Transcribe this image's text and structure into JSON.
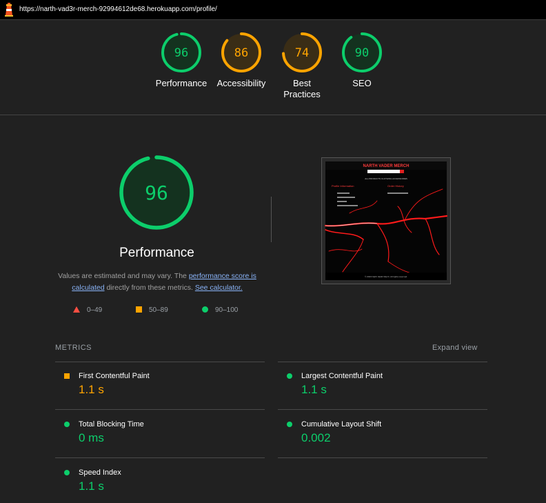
{
  "browser": {
    "url": "https://narth-vad3r-merch-92994612de68.herokuapp.com/profile/"
  },
  "categories": [
    {
      "label_line1": "Performance",
      "label_line2": "",
      "score": "96",
      "value": 96,
      "color": "#0cce6b",
      "fill": "#14321f"
    },
    {
      "label_line1": "Accessibility",
      "label_line2": "",
      "score": "86",
      "value": 86,
      "color": "#ffa400",
      "fill": "#3a2d16"
    },
    {
      "label_line1": "Best",
      "label_line2": "Practices",
      "score": "74",
      "value": 74,
      "color": "#ffa400",
      "fill": "#3a2d16"
    },
    {
      "label_line1": "SEO",
      "label_line2": "",
      "score": "90",
      "value": 90,
      "color": "#0cce6b",
      "fill": "#14321f"
    }
  ],
  "main": {
    "score": "96",
    "value": 96,
    "title": "Performance",
    "desc_prefix": "Values are estimated and may vary. The ",
    "link1": "performance score is calculated",
    "desc_mid": " directly from these metrics. ",
    "link2": "See calculator."
  },
  "legend": {
    "fail": "0–49",
    "average": "50–89",
    "pass": "90–100"
  },
  "metrics": {
    "heading": "METRICS",
    "expand": "Expand view",
    "items": [
      {
        "name": "First Contentful Paint",
        "value": "1.1 s",
        "status": "average"
      },
      {
        "name": "Largest Contentful Paint",
        "value": "1.1 s",
        "status": "pass"
      },
      {
        "name": "Total Blocking Time",
        "value": "0 ms",
        "status": "pass"
      },
      {
        "name": "Cumulative Layout Shift",
        "value": "0.002",
        "status": "pass"
      },
      {
        "name": "Speed Index",
        "value": "1.1 s",
        "status": "pass"
      }
    ]
  },
  "screenshot": {
    "site_title": "NARTH VADER MERCH",
    "nav": "ALL PRODUCTS   CLOTHING   ACCESSORIES",
    "left_heading": "Profile Information",
    "right_heading": "Order History",
    "footer": "© 2023 Narth Vad3r Merch. All rights reserved."
  }
}
